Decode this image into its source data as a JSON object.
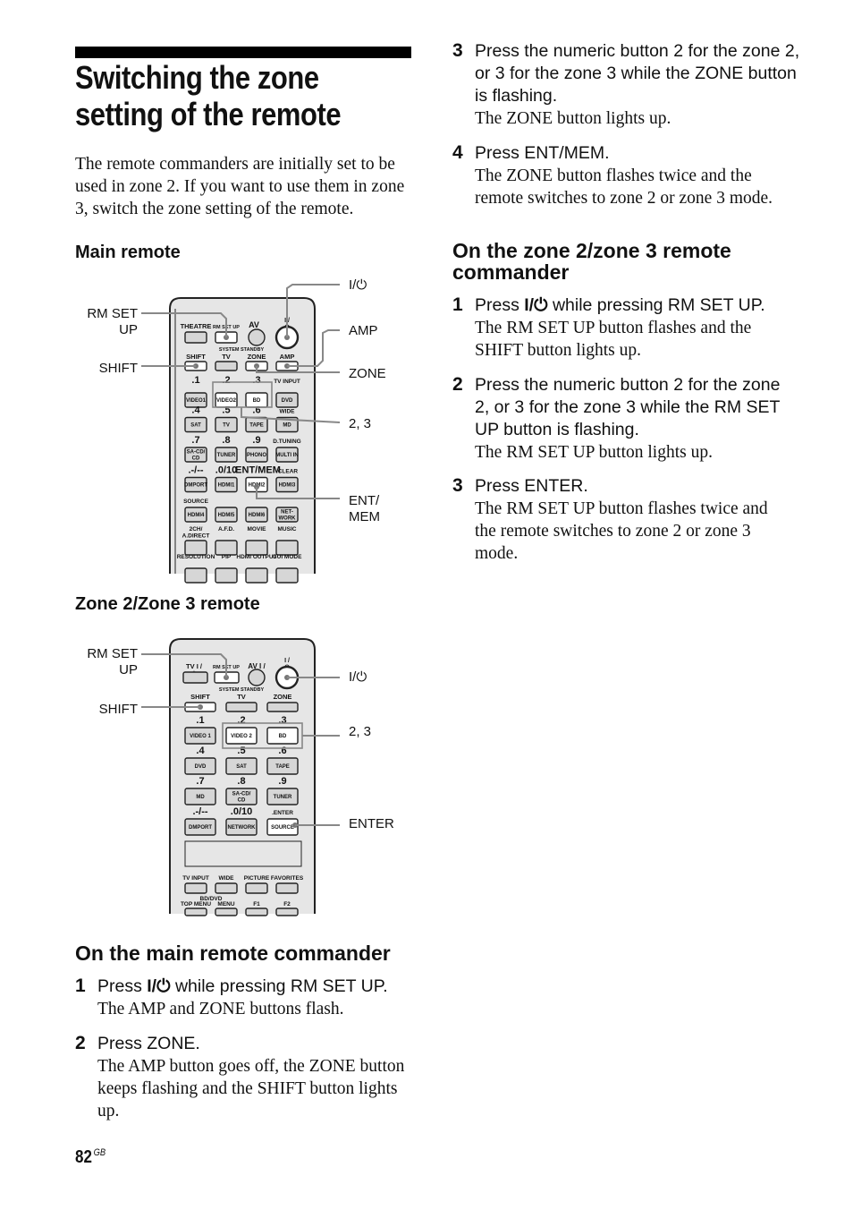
{
  "page": {
    "title_lines": [
      "Switching the zone",
      "setting of the remote"
    ],
    "intro": "The remote commanders are initially set to be used in zone 2. If you want to use them in zone 3, switch the zone setting of the remote.",
    "page_number": "82",
    "page_suffix": "GB"
  },
  "main_remote": {
    "heading": "Main remote",
    "callouts_left": [
      "RM SET\nUP",
      "SHIFT"
    ],
    "callouts_right": [
      "I/⏻",
      "AMP",
      "ZONE",
      "2, 3",
      "ENT/\nMEM"
    ],
    "top_labels": [
      "THEATRE",
      "RM SET UP",
      "AV",
      "I / ⏻"
    ],
    "system_standby": "SYSTEM STANDBY",
    "row_labels": [
      "SHIFT",
      "TV",
      "ZONE",
      "AMP"
    ],
    "grid": [
      {
        "tops": [
          ".1",
          ".2",
          ".3",
          "TV INPUT"
        ],
        "buttons": [
          "VIDEO1",
          "VIDEO2",
          "BD",
          "DVD"
        ]
      },
      {
        "tops": [
          ".4",
          ".5",
          ".6",
          "WIDE"
        ],
        "buttons": [
          "SAT",
          "TV",
          "TAPE",
          "MD"
        ]
      },
      {
        "tops": [
          ".7",
          ".8",
          ".9",
          "D.TUNING"
        ],
        "buttons": [
          "SA-CD/ CD",
          "TUNER",
          "PHONO",
          "MULTI IN"
        ]
      },
      {
        "tops": [
          ".-/--",
          ".0/10",
          ".ENT/MEM",
          ".CLEAR"
        ],
        "buttons": [
          "DMPORT",
          "HDMI1",
          "HDMI2",
          "HDMI3"
        ]
      },
      {
        "tops": [
          "SOURCE",
          "",
          "",
          ""
        ],
        "buttons": [
          "HDMI4",
          "HDMI5",
          "HDMI6",
          "NET- WORK"
        ]
      },
      {
        "tops": [
          "2CH/ A.DIRECT",
          "A.F.D.",
          "MOVIE",
          "MUSIC"
        ],
        "buttons": [
          "",
          "",
          "",
          ""
        ]
      },
      {
        "tops": [
          "RESOLUTION",
          "PIP",
          "HDMI OUTPUT",
          "GUI MODE"
        ],
        "buttons": [
          "",
          "",
          "",
          ""
        ]
      }
    ]
  },
  "zone_remote": {
    "heading": "Zone 2/Zone 3 remote",
    "callouts_left": [
      "RM SET\nUP",
      "SHIFT"
    ],
    "callouts_right": [
      "I/⏻",
      "2, 3",
      "ENTER"
    ],
    "top_labels": [
      "TV I / ⏻",
      "RM SET UP",
      "AV I / ⏻",
      "I / ⏻"
    ],
    "system_standby": "SYSTEM STANDBY",
    "row_labels": [
      "SHIFT",
      "TV",
      "ZONE"
    ],
    "grid": [
      {
        "tops": [
          ".1",
          ".2",
          ".3"
        ],
        "buttons": [
          "VIDEO 1",
          "VIDEO 2",
          "BD"
        ]
      },
      {
        "tops": [
          ".4",
          ".5",
          ".6"
        ],
        "buttons": [
          "DVD",
          "SAT",
          "TAPE"
        ]
      },
      {
        "tops": [
          ".7",
          ".8",
          ".9"
        ],
        "buttons": [
          "MD",
          "SA-CD/ CD",
          "TUNER"
        ]
      },
      {
        "tops": [
          ".-/--",
          ".0/10",
          ".ENTER"
        ],
        "buttons": [
          "DMPORT",
          "NETWORK",
          "SOURCE"
        ]
      }
    ],
    "bottom_labels": [
      "TV INPUT",
      "WIDE",
      "PICTURE",
      "FAVORITES"
    ],
    "bd_dvd": "BD/DVD",
    "bottom_labels2": [
      "TOP MENU",
      "MENU",
      "F1",
      "F2"
    ]
  },
  "main_section": {
    "heading": "On the main remote commander",
    "steps": [
      {
        "num": "1",
        "instruction_pre": "Press ",
        "power_symbol": "I/⏻",
        "instruction_post": " while pressing RM SET UP.",
        "result": "The AMP and ZONE buttons flash."
      },
      {
        "num": "2",
        "instruction": "Press ZONE.",
        "result": "The AMP button goes off, the ZONE button keeps flashing and the SHIFT button lights up."
      },
      {
        "num": "3",
        "instruction": "Press the numeric button 2 for the zone 2, or 3 for the zone 3 while the ZONE button is flashing.",
        "result": "The ZONE button lights up."
      },
      {
        "num": "4",
        "instruction": "Press ENT/MEM.",
        "result": "The ZONE button flashes twice and the remote switches to zone 2 or zone 3 mode."
      }
    ]
  },
  "zone_section": {
    "heading": "On the zone 2/zone 3 remote commander",
    "steps": [
      {
        "num": "1",
        "instruction_pre": "Press ",
        "power_symbol": "I/⏻",
        "instruction_post": " while pressing RM SET UP.",
        "result": "The RM SET UP button flashes and the SHIFT button lights up."
      },
      {
        "num": "2",
        "instruction": "Press the numeric button 2 for the zone 2, or 3 for the zone 3 while the RM SET UP button is flashing.",
        "result": "The RM SET UP button lights up."
      },
      {
        "num": "3",
        "instruction": "Press ENTER.",
        "result": "The RM SET UP button flashes twice and the remote switches to zone 2 or zone 3 mode."
      }
    ]
  }
}
